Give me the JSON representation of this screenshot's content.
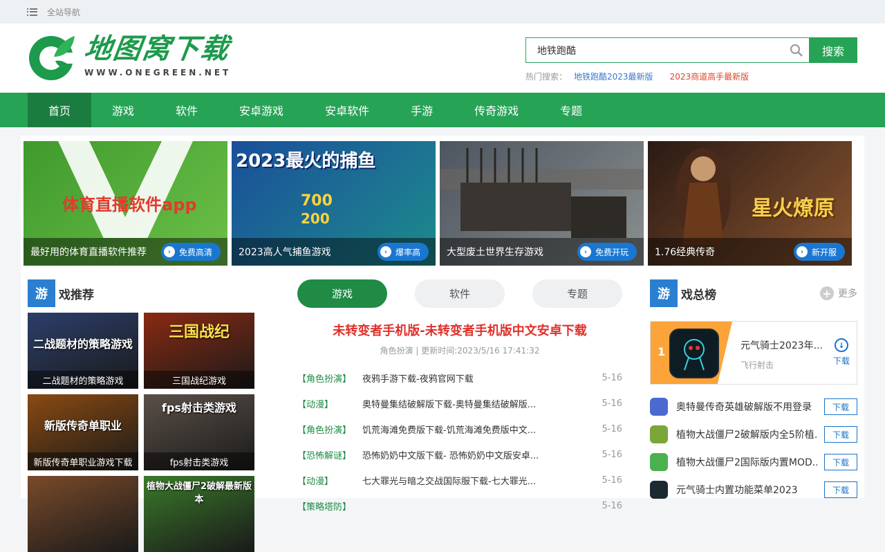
{
  "topbar": {
    "nav_label": "全站导航"
  },
  "logo": {
    "cn": "地图窝下载",
    "en": "WWW.ONEGREEN.NET"
  },
  "search": {
    "value": "地铁跑酷",
    "button": "搜索",
    "hot_label": "热门搜索：",
    "hot": [
      "地铁跑酷2023最新版",
      "2023商道高手最新版"
    ]
  },
  "nav": [
    "首页",
    "游戏",
    "软件",
    "安卓游戏",
    "安卓软件",
    "手游",
    "传奇游戏",
    "专题"
  ],
  "banners": [
    {
      "caption": "最好用的体育直播软件推荐",
      "tag": "免费高清",
      "overlay": "体育直播软件app",
      "colors": [
        "#3f9a2d",
        "#6dc048"
      ]
    },
    {
      "caption": "2023高人气捕鱼游戏",
      "tag": "爆率高",
      "overlay": "2023最火的捕鱼",
      "colors": [
        "#1a4f9a",
        "#1d8b8c"
      ]
    },
    {
      "caption": "大型废土世界生存游戏",
      "tag": "免费开玩",
      "overlay": "",
      "colors": [
        "#4d5560",
        "#8a8f8e"
      ]
    },
    {
      "caption": "1.76经典传奇",
      "tag": "新开服",
      "overlay": "星火燎原",
      "colors": [
        "#2a1a14",
        "#8a5530"
      ]
    }
  ],
  "left": {
    "title_block": "游",
    "title_rest": "戏推荐",
    "cards": [
      {
        "label": "二战题材的策略游戏",
        "overlay": "二战题材的策略游戏",
        "color": "#2c3e6a"
      },
      {
        "label": "三国战纪游戏",
        "overlay": "三国战纪",
        "color": "#8a2a12"
      },
      {
        "label": "新版传奇单职业游戏下载",
        "overlay": "新版传奇单职业",
        "color": "#8a4a12"
      },
      {
        "label": "fps射击类游戏",
        "overlay": "fps射击类游戏",
        "color": "#5a5048"
      },
      {
        "label": "",
        "overlay": "",
        "color": "#7a4a2a"
      },
      {
        "label": "",
        "overlay": "植物大战僵尸2破解最新版本",
        "color": "#3a7a2a"
      }
    ]
  },
  "center": {
    "tabs": [
      "游戏",
      "软件",
      "专题"
    ],
    "headline": "未转变者手机版-未转变者手机版中文安卓下载",
    "meta": "角色扮演 | 更新时间:2023/5/16 17:41:32",
    "news": [
      {
        "cat": "【角色扮演】",
        "title": "夜鸦手游下载-夜鸦官网下载",
        "date": "5-16"
      },
      {
        "cat": "【动漫】",
        "title": "奥特曼集结破解版下载-奥特曼集结破解版...",
        "date": "5-16"
      },
      {
        "cat": "【角色扮演】",
        "title": "饥荒海滩免费版下载-饥荒海滩免费版中文...",
        "date": "5-16"
      },
      {
        "cat": "【恐怖解谜】",
        "title": "恐怖奶奶中文版下载- 恐怖奶奶中文版安卓...",
        "date": "5-16"
      },
      {
        "cat": "【动漫】",
        "title": "七大罪光与暗之交战国际服下载-七大罪光...",
        "date": "5-16"
      },
      {
        "cat": "【策略塔防】",
        "title": "",
        "date": "5-16"
      }
    ]
  },
  "right": {
    "title_block": "游",
    "title_rest": "戏总榜",
    "more": "更多",
    "top1": {
      "rank": "1",
      "name": "元气骑士2023年...",
      "sub": "飞行射击",
      "dl": "下载"
    },
    "list": [
      {
        "name": "奥特曼传奇英雄破解版不用登录",
        "btn": "下载",
        "color": "#4a6ad0"
      },
      {
        "name": "植物大战僵尸2破解版内全5阶植...",
        "btn": "下载",
        "color": "#7aa63a"
      },
      {
        "name": "植物大战僵尸2国际版内置MOD...",
        "btn": "下载",
        "color": "#4ab050"
      },
      {
        "name": "元气骑士内置功能菜单2023",
        "btn": "下载",
        "color": "#1a2a30"
      }
    ]
  }
}
